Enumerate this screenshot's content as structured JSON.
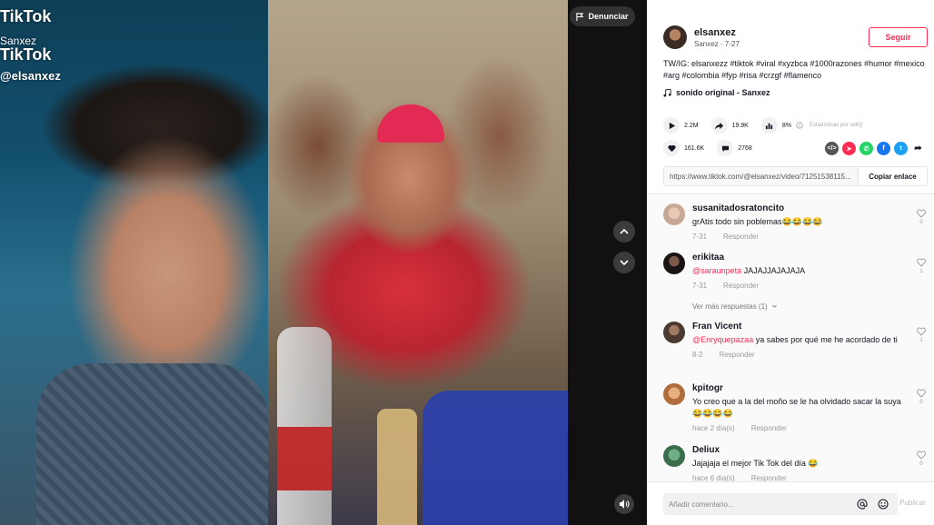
{
  "video": {
    "watermark": {
      "logo": "TikTok",
      "name": "Sanxez",
      "logo2": "TikTok",
      "handle": "@elsanxez"
    },
    "report_label": "Denunciar"
  },
  "author": {
    "username": "elsanxez",
    "display_name": "Sanxez",
    "date": "7-27",
    "follow_label": "Seguir"
  },
  "description": "TW/IG: elsanxezz #tiktok #viral #xyzbca #1000razones #humor #mexico #arg #colombia #fyp #risa #crzgf #flamenco",
  "sound": "sonido original - Sanxez",
  "stats": {
    "plays": "2.2M",
    "shares": "19.9K",
    "score": "8%",
    "score_note": "Estadísticas por vidIQ",
    "likes": "161.6K",
    "comments": "2768"
  },
  "share_colors": {
    "embed": "#555555",
    "send": "#fe2c55",
    "whatsapp": "#25d366",
    "facebook": "#1877f2",
    "twitter": "#1da1f2"
  },
  "link": {
    "url": "https://www.tiktok.com/@elsanxez/video/71251538115...",
    "copy_label": "Copiar enlace"
  },
  "comments": [
    {
      "user": "susanitadosratoncito",
      "mention": "",
      "text": "grAtis todo sin poblemas😂😂😂😂",
      "date": "7-31",
      "reply": "Responder",
      "likes": "0"
    },
    {
      "user": "erikitaa",
      "mention": "@saraunpeta",
      "text": " JAJAJJAJAJAJA",
      "date": "7-31",
      "reply": "Responder",
      "likes": "1"
    },
    {
      "user": "Fran Vicent",
      "mention": "@Enryquepazaa",
      "text": " ya sabes por qué me he acordado de ti",
      "date": "8-2",
      "reply": "Responder",
      "likes": "1"
    },
    {
      "user": "kpitogr",
      "mention": "",
      "text": "Yo creo que a la del moño se le ha olvidado sacar la suya😂😂😂😂",
      "date": "hace 2 día(s)",
      "reply": "Responder",
      "likes": "0"
    },
    {
      "user": "Deliux",
      "mention": "",
      "text": "Jajajaja el mejor Tik Tok del día 😂",
      "date": "hace 6 día(s)",
      "reply": "Responder",
      "likes": "0"
    }
  ],
  "more_replies": "Ver más respuestas (1)",
  "comment_box": {
    "placeholder": "Añadir comentario...",
    "post_label": "Publicar"
  }
}
